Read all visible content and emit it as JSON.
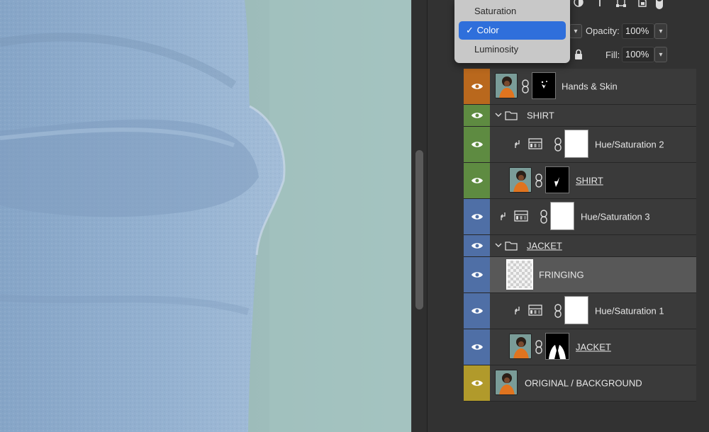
{
  "blend_menu": {
    "items": [
      {
        "label": "Saturation",
        "selected": false
      },
      {
        "label": "Color",
        "selected": true
      },
      {
        "label": "Luminosity",
        "selected": false
      }
    ],
    "check_mark": "✓"
  },
  "layers_panel": {
    "opacity_label": "Opacity:",
    "opacity_value": "100%",
    "fill_label": "Fill:",
    "fill_value": "100%",
    "filter_icons": [
      "adjustment-filter-icon",
      "type-filter-icon",
      "shape-filter-icon",
      "smart-object-filter-icon",
      "filter-toggle-icon"
    ]
  },
  "layers": [
    {
      "name": "Hands & Skin",
      "kind": "pixel-with-mask",
      "color": "#b9681d"
    },
    {
      "name": "SHIRT",
      "kind": "group",
      "color": "#5e8b41"
    },
    {
      "name": "Hue/Saturation 2",
      "kind": "adjustment-clipped",
      "color": "#5e8b41"
    },
    {
      "name": "SHIRT",
      "kind": "pixel-with-mask",
      "color": "#5e8b41"
    },
    {
      "name": "Hue/Saturation 3",
      "kind": "adjustment-clipped",
      "color": "#4f6fa6"
    },
    {
      "name": "JACKET",
      "kind": "group",
      "color": "#4f6fa6"
    },
    {
      "name": "FRINGING",
      "kind": "empty-pixel",
      "color": "#4f6fa6",
      "selected": true
    },
    {
      "name": "Hue/Saturation 1",
      "kind": "adjustment-clipped",
      "color": "#4f6fa6"
    },
    {
      "name": "JACKET",
      "kind": "pixel-with-mask",
      "color": "#4f6fa6"
    },
    {
      "name": "ORIGINAL / BACKGROUND",
      "kind": "pixel",
      "color": "#b19a2b"
    }
  ],
  "colors": {
    "accent_blue": "#2f6fdb",
    "label_orange": "#b9681d",
    "label_green": "#5e8b41",
    "label_blue": "#4f6fa6",
    "label_yellow": "#b19a2b"
  }
}
